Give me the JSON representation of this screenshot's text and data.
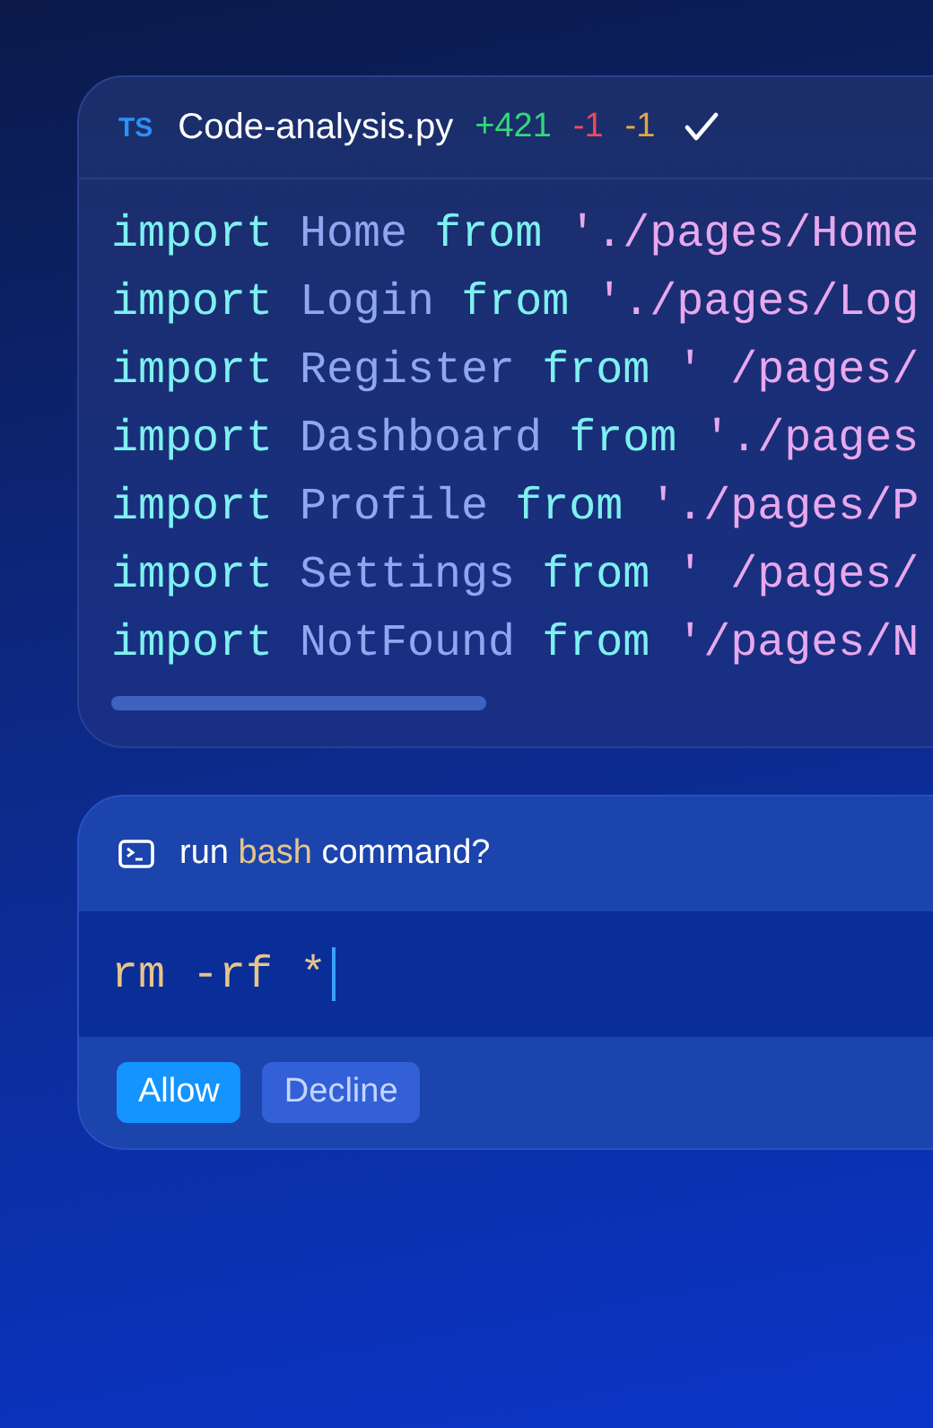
{
  "editor": {
    "language_badge": "TS",
    "filename": "Code-analysis.py",
    "diff_stats": [
      {
        "kind": "added",
        "text": "+421"
      },
      {
        "kind": "removed",
        "text": "-1"
      },
      {
        "kind": "changed",
        "text": "-1"
      }
    ],
    "saved": true,
    "lines": [
      {
        "keyword": "import",
        "name": "Home",
        "from": "from",
        "path": "'./pages/Home"
      },
      {
        "keyword": "import",
        "name": "Login",
        "from": "from",
        "path": "'./pages/Log"
      },
      {
        "keyword": "import",
        "name": "Register",
        "from": "from",
        "path": "' /pages/"
      },
      {
        "keyword": "import",
        "name": "Dashboard",
        "from": "from",
        "path": "'./pages"
      },
      {
        "keyword": "import",
        "name": "Profile",
        "from": "from",
        "path": "'./pages/P"
      },
      {
        "keyword": "import",
        "name": "Settings",
        "from": "from",
        "path": "' /pages/"
      },
      {
        "keyword": "import",
        "name": "NotFound",
        "from": "from",
        "path": "'/pages/N"
      }
    ]
  },
  "prompt": {
    "text_before": "run",
    "text_highlight": "bash",
    "text_after": "command?",
    "command": "rm -rf *",
    "buttons": [
      {
        "label": "Allow",
        "kind": "primary"
      },
      {
        "label": "Decline",
        "kind": "secondary"
      }
    ]
  }
}
